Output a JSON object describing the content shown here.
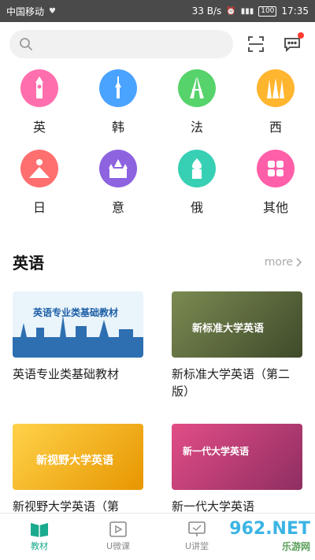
{
  "statusbar": {
    "carrier": "中国移动",
    "speed": "33 B/s",
    "battery": "100",
    "time": "17:35"
  },
  "search": {
    "placeholder": ""
  },
  "languages": [
    {
      "label": "英",
      "color": "#ff6fae",
      "icon": "big-ben-icon"
    },
    {
      "label": "韩",
      "color": "#4aa3ff",
      "icon": "tower-icon"
    },
    {
      "label": "法",
      "color": "#56d36b",
      "icon": "eiffel-tower-icon"
    },
    {
      "label": "西",
      "color": "#ffb52e",
      "icon": "cathedral-icon"
    },
    {
      "label": "日",
      "color": "#ff6f6f",
      "icon": "mount-fuji-icon"
    },
    {
      "label": "意",
      "color": "#8d63e0",
      "icon": "duomo-icon"
    },
    {
      "label": "俄",
      "color": "#38d0b4",
      "icon": "onion-dome-icon"
    },
    {
      "label": "其他",
      "color": "#ff5fa8",
      "icon": "grid-icon"
    }
  ],
  "section": {
    "title": "英语",
    "more": "more"
  },
  "books": [
    {
      "title": "英语专业类基础教材",
      "cover_text": "英语专业类基础教材",
      "cover_color": "#eaf4fb"
    },
    {
      "title": "新标准大学英语（第二版）",
      "cover_text": "新标准大学英语",
      "cover_color": "#5d6b3f"
    },
    {
      "title": "新视野大学英语（第",
      "cover_text": "新视野大学英语",
      "cover_color": "#f4b000"
    },
    {
      "title": "新一代大学英语",
      "cover_text": "新一代大学英语",
      "cover_color": "#c43d6f"
    }
  ],
  "bottomnav": [
    {
      "label": "教材",
      "active": true
    },
    {
      "label": "U微课",
      "active": false
    },
    {
      "label": "U讲堂",
      "active": false
    }
  ],
  "watermark": {
    "text": "962.NET",
    "sub": "乐游网"
  }
}
